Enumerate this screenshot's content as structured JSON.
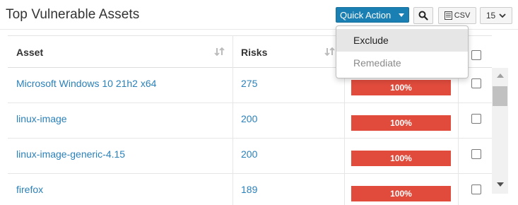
{
  "panel": {
    "title": "Top Vulnerable Assets"
  },
  "toolbar": {
    "quick_action_label": "Quick Action",
    "csv_label": "CSV",
    "page_size": "15"
  },
  "dropdown": {
    "items": [
      {
        "label": "Exclude",
        "state": "hover"
      },
      {
        "label": "Remediate",
        "state": "normal"
      }
    ]
  },
  "table": {
    "columns": [
      "Asset",
      "Risks"
    ],
    "rows": [
      {
        "asset": "Microsoft Windows 10 21h2 x64",
        "risks": "275",
        "bar": "100%"
      },
      {
        "asset": "linux-image",
        "risks": "200",
        "bar": "100%"
      },
      {
        "asset": "linux-image-generic-4.15",
        "risks": "200",
        "bar": "100%"
      },
      {
        "asset": "firefox",
        "risks": "189",
        "bar": "100%"
      }
    ]
  },
  "colors": {
    "accent": "#1a7fb2",
    "link": "#2a80b9",
    "risk_bar": "#e04b3c"
  },
  "icons": {
    "search": "search-icon",
    "csv": "csv-file-icon",
    "sort": "sort-icon",
    "chevron": "chevron-down-icon"
  }
}
